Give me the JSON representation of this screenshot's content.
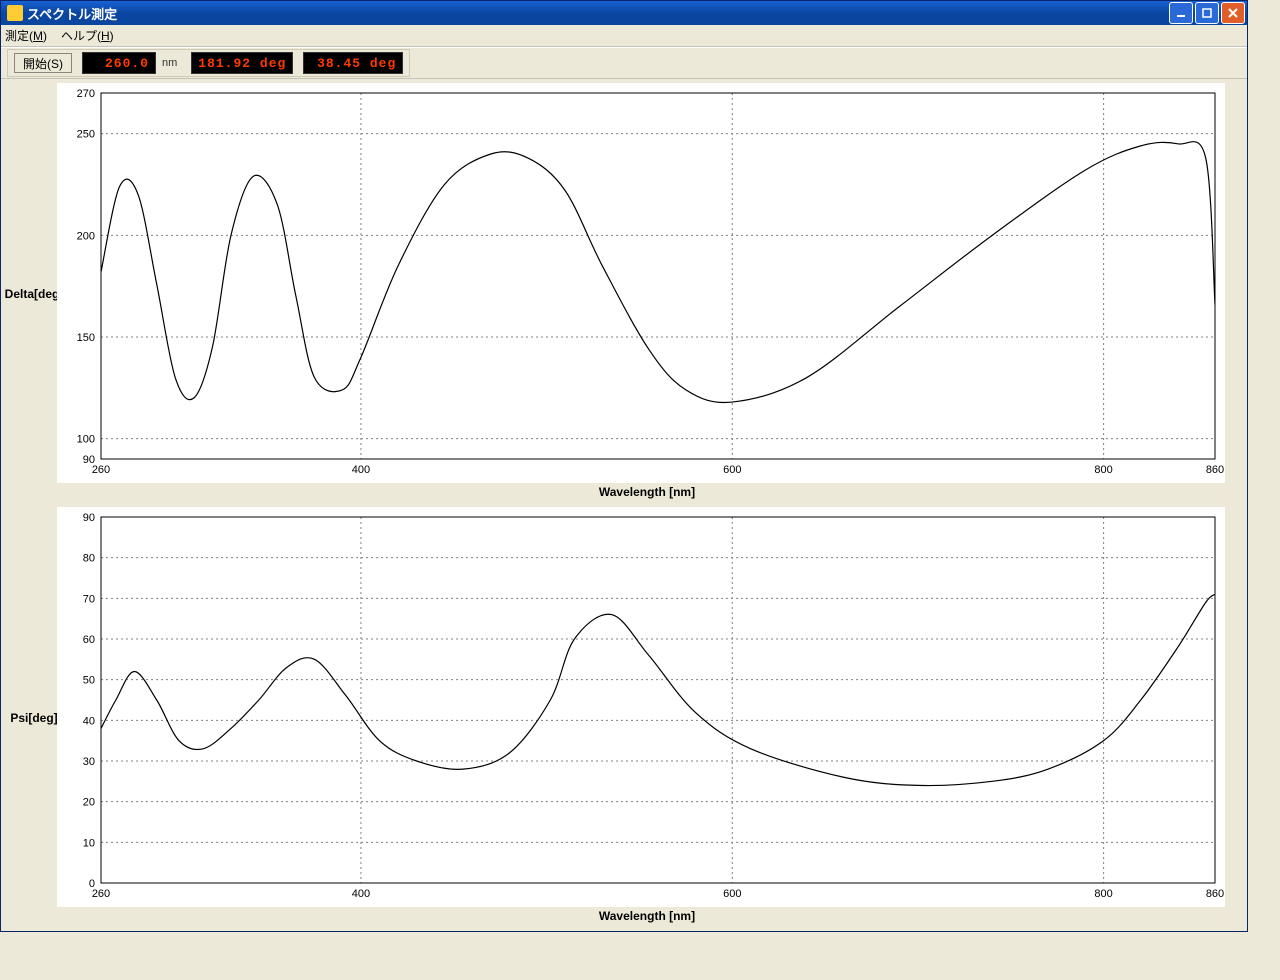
{
  "window": {
    "title": "スペクトル測定"
  },
  "menu": {
    "measure": "測定(M)",
    "help": "ヘルプ(H)",
    "measure_plain": "測定(",
    "measure_u": "M",
    "measure_tail": ")",
    "help_plain": "ヘルプ(",
    "help_u": "H",
    "help_tail": ")"
  },
  "toolbar": {
    "start": "開始(S)",
    "wavelength_value": "260.0",
    "wavelength_unit": "nm",
    "delta_value": "181.92 deg",
    "psi_value": "38.45 deg"
  },
  "chart_data": [
    {
      "type": "line",
      "title": "",
      "xlabel": "Wavelength [nm]",
      "ylabel": "Delta[deg]",
      "xlim": [
        260,
        860
      ],
      "ylim": [
        90,
        270
      ],
      "xticks": [
        260,
        400,
        600,
        800,
        860
      ],
      "yticks": [
        90,
        100,
        150,
        200,
        250,
        270
      ],
      "series": [
        {
          "name": "Delta",
          "x": [
            260,
            270,
            280,
            290,
            300,
            310,
            320,
            330,
            342,
            355,
            365,
            375,
            390,
            400,
            420,
            445,
            470,
            490,
            510,
            530,
            555,
            575,
            600,
            640,
            690,
            740,
            790,
            820,
            840,
            855,
            860
          ],
          "values": [
            182,
            224,
            220,
            176,
            130,
            120,
            145,
            200,
            229,
            215,
            170,
            130,
            124,
            140,
            185,
            225,
            240,
            238,
            222,
            185,
            144,
            124,
            118,
            130,
            165,
            200,
            232,
            244,
            245,
            238,
            166
          ]
        }
      ]
    },
    {
      "type": "line",
      "title": "",
      "xlabel": "Wavelength [nm]",
      "ylabel": "Psi[deg]",
      "xlim": [
        260,
        860
      ],
      "ylim": [
        0,
        90
      ],
      "xticks": [
        260,
        400,
        600,
        800,
        860
      ],
      "yticks": [
        0,
        10,
        20,
        30,
        40,
        50,
        60,
        70,
        80,
        90
      ],
      "series": [
        {
          "name": "Psi",
          "x": [
            260,
            268,
            278,
            290,
            302,
            315,
            330,
            345,
            360,
            375,
            392,
            410,
            430,
            455,
            480,
            502,
            515,
            535,
            555,
            580,
            610,
            660,
            700,
            740,
            770,
            800,
            820,
            840,
            855,
            860
          ],
          "values": [
            38,
            45,
            52,
            45,
            35,
            33,
            38,
            45,
            53,
            55,
            46,
            35,
            30,
            28,
            32,
            45,
            60,
            66,
            56,
            42,
            33,
            26,
            24,
            25,
            28,
            35,
            45,
            58,
            69,
            71
          ]
        }
      ]
    }
  ]
}
